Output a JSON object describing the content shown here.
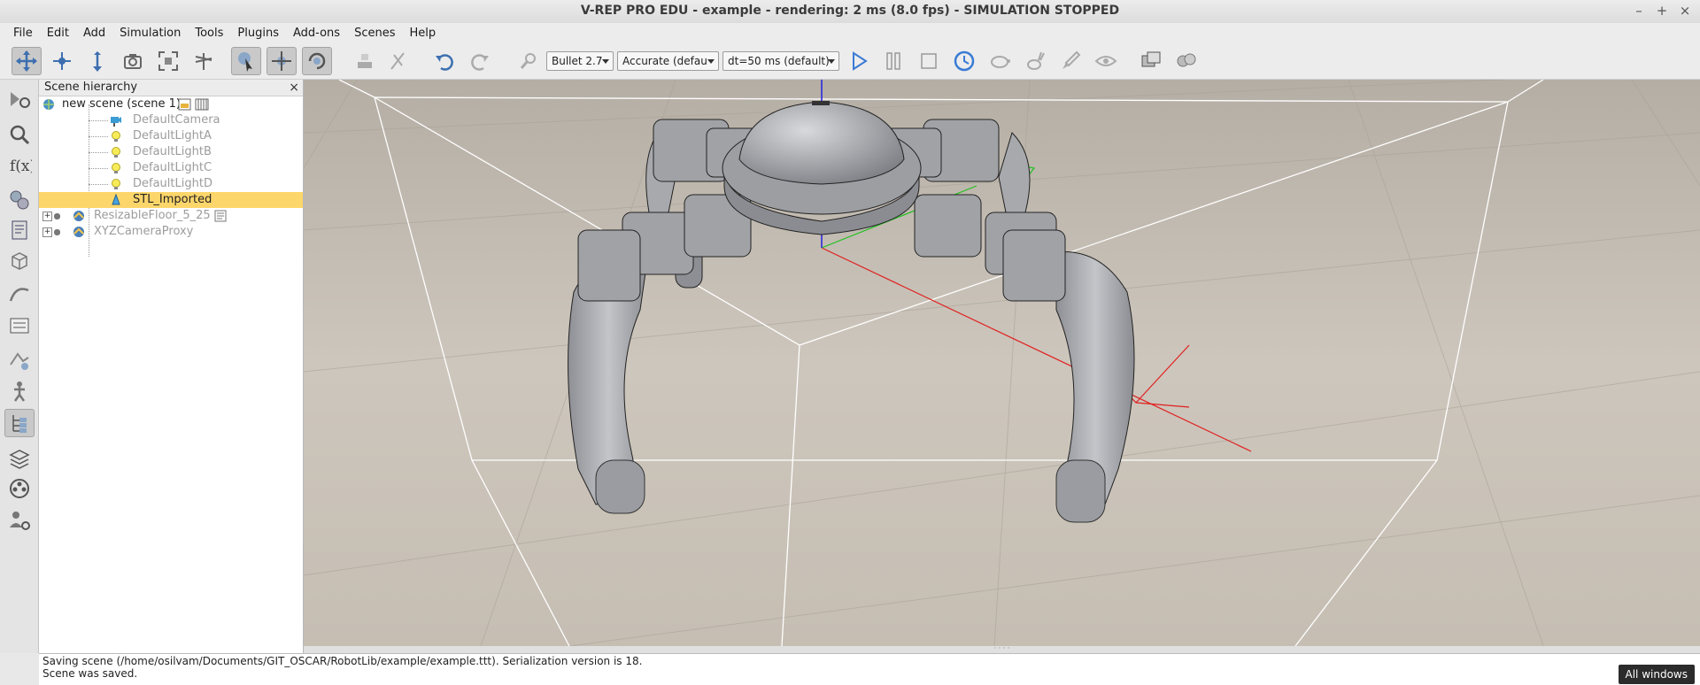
{
  "window": {
    "title": "V-REP PRO EDU - example - rendering: 2 ms (8.0 fps) - SIMULATION STOPPED",
    "minimize": "–",
    "maximize": "+",
    "close": "×"
  },
  "menu": [
    "File",
    "Edit",
    "Add",
    "Simulation",
    "Tools",
    "Plugins",
    "Add-ons",
    "Scenes",
    "Help"
  ],
  "toolbar": {
    "engine": "Bullet 2.7",
    "accuracy": "Accurate (defau",
    "timestep": "dt=50 ms (default)"
  },
  "hierarchy": {
    "title": "Scene hierarchy",
    "close": "×",
    "root": "new scene (scene 1)",
    "items": [
      {
        "label": "DefaultCamera"
      },
      {
        "label": "DefaultLightA"
      },
      {
        "label": "DefaultLightB"
      },
      {
        "label": "DefaultLightC"
      },
      {
        "label": "DefaultLightD"
      },
      {
        "label": "STL_Imported"
      },
      {
        "label": "ResizableFloor_5_25"
      },
      {
        "label": "XYZCameraProxy"
      }
    ]
  },
  "status": {
    "line1": "Saving scene (/home/osilvam/Documents/GIT_OSCAR/RobotLib/example/example.ttt). Serialization version is 18.",
    "line2": "Scene was saved."
  },
  "all_windows": "All windows",
  "colors": {
    "selection": "#fdd66b",
    "play": "#3a7bd5",
    "axis_x": "#e02020",
    "axis_y": "#20c020",
    "axis_z": "#2020e0"
  }
}
